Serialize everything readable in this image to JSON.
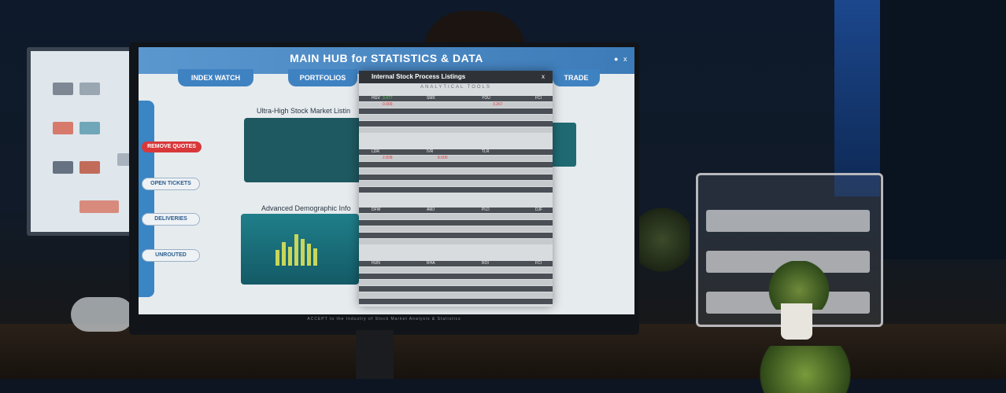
{
  "screen": {
    "title": "MAIN HUB for STATISTICS & DATA",
    "window_controls": [
      "●",
      "x"
    ],
    "nav_tabs": [
      "INDEX WATCH",
      "PORTFOLIOS",
      "TRADE"
    ],
    "side_buttons": [
      "REMOVE QUOTES",
      "OPEN TICKETS",
      "DELIVERIES",
      "UNROUTED"
    ],
    "panel_titles": [
      "Ultra-High Stock Market Listin",
      "Advanced Demographic Info"
    ],
    "footer": "ACCEPT to the Industry of Stock Market Analysis & Statistics"
  },
  "popup": {
    "title": "Internal Stock Process Listings",
    "subtitle": "ANALYTICAL TOOLS",
    "close": "x"
  },
  "sample_tickers": {
    "row1": [
      "HGV",
      "3.477",
      "SMX",
      "YOU",
      "FCI"
    ],
    "row2": [
      "0.009",
      "3.267"
    ],
    "row3": [
      "LDR",
      "IVR",
      "TLR"
    ],
    "row4": [
      "2.828",
      "8.000"
    ],
    "row5": [
      "DFW",
      "AMJ",
      "PLD",
      "DJF"
    ],
    "row6": [
      "HUN",
      "RHA",
      "ROI",
      "FCI"
    ]
  },
  "accent_colors": {
    "hub_blue": "#3c7bb8",
    "remove_red": "#d9383a",
    "gain_green": "#4fd64f",
    "loss_red": "#e23b3b"
  }
}
